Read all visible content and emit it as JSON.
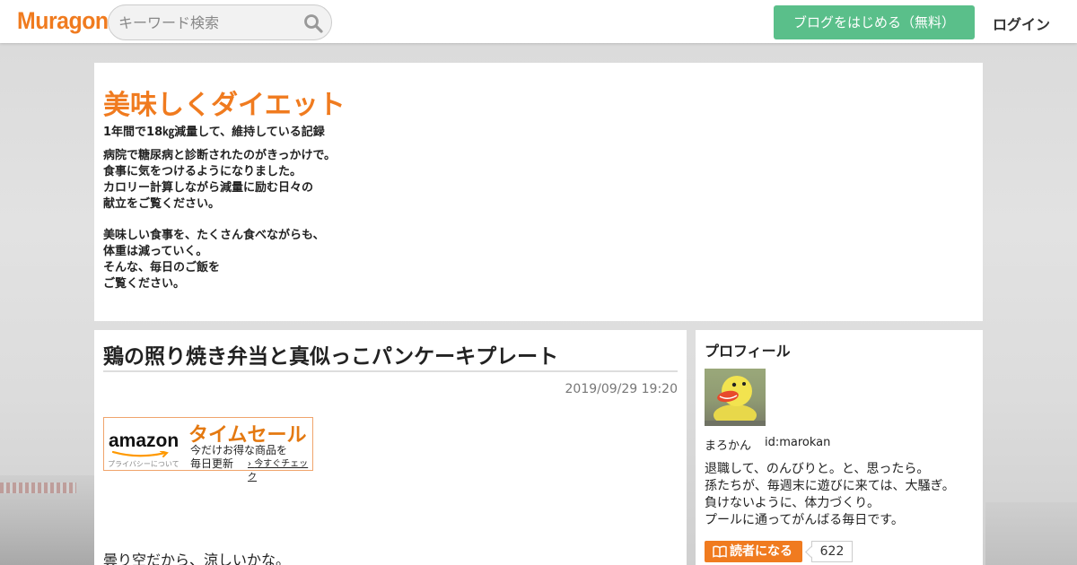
{
  "header": {
    "logo": "Muragon",
    "search": {
      "placeholder": "キーワード検索"
    },
    "cta_label": "ブログをはじめる（無料）",
    "login_label": "ログイン"
  },
  "blog": {
    "title": "美味しくダイエット",
    "subtitle": "1年間で18㎏減量して、維持している記録",
    "desc_para1": [
      "病院で糖尿病と診断されたのがきっかけで。",
      "食事に気をつけるようになりました。",
      "カロリー計算しながら減量に励む日々の",
      "献立をご覧ください。"
    ],
    "desc_para2": [
      "美味しい食事を、たくさん食べながらも、",
      "体重は減っていく。",
      "そんな、毎日のご飯を",
      "ご覧ください。"
    ]
  },
  "article": {
    "title": "鶏の照り焼き弁当と真似っこパンケーキプレート",
    "date": "2019/09/29 19:20",
    "body_first_line": "曇り空だから、涼しいかな。"
  },
  "ad": {
    "logo": "amazon",
    "privacy": "プライバシーについて",
    "headline": "タイムセール",
    "line1": "今だけお得な商品を",
    "line2": "毎日更新",
    "check_label": "今すぐチェック"
  },
  "profile": {
    "heading": "プロフィール",
    "name": "まろかん",
    "id": "id:marokan",
    "bio": [
      "退職して、のんびりと。と、思ったら。",
      "孫たちが、毎週末に遊びに来ては、大騒ぎ。",
      "負けないように、体力づくり。",
      "プールに通ってがんばる毎日です。"
    ],
    "follow_label": "読者になる",
    "follower_count": "622"
  },
  "colors": {
    "brand_orange": "#f07b1f",
    "cta_green": "#5abf8a"
  }
}
